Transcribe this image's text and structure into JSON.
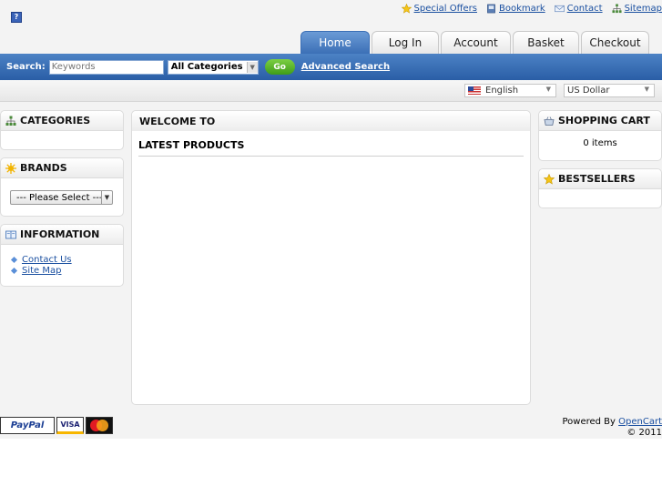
{
  "header": {
    "logo_icon_label": "?",
    "links": [
      {
        "label": "Special Offers",
        "icon": "star-icon"
      },
      {
        "label": "Bookmark",
        "icon": "bookmark-icon"
      },
      {
        "label": "Contact",
        "icon": "envelope-icon"
      },
      {
        "label": "Sitemap",
        "icon": "sitemap-icon"
      }
    ]
  },
  "tabs": [
    "Home",
    "Log In",
    "Account",
    "Basket",
    "Checkout"
  ],
  "search": {
    "label": "Search:",
    "placeholder": "Keywords",
    "category": "All Categories",
    "go_label": "Go",
    "advanced_label": "Advanced Search"
  },
  "locale": {
    "language": "English",
    "currency": "US Dollar"
  },
  "left": {
    "categories_title": "CATEGORIES",
    "brands_title": "BRANDS",
    "brands_select": "--- Please Select ---",
    "information_title": "INFORMATION",
    "information_links": [
      "Contact Us",
      "Site Map"
    ]
  },
  "main": {
    "welcome_title": "WELCOME TO",
    "latest_title": "LATEST PRODUCTS"
  },
  "right": {
    "cart_title": "SHOPPING CART",
    "cart_text": "0 items",
    "bestsellers_title": "BESTSELLERS"
  },
  "footer": {
    "payments": [
      "PayPal",
      "VISA",
      "MasterCard"
    ],
    "powered_by": "Powered By",
    "powered_link": "OpenCart",
    "copyright": "© 2011"
  },
  "colors": {
    "accent": "#3b6fb6",
    "link": "#1a4fa0",
    "go": "#4aa820"
  }
}
